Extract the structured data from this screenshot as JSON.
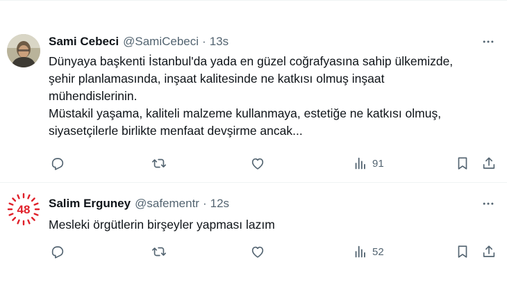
{
  "tweets": [
    {
      "name": "Sami Cebeci",
      "handle": "@SamiCebeci",
      "separator": "·",
      "time": "13s",
      "lines": [
        "Dünyaya başkenti İstanbul'da yada en güzel coğrafyasına sahip ülkemizde,",
        "şehir planlamasında, inşaat kalitesinde ne katkısı olmuş inşaat",
        "mühendislerinin.",
        "Müstakil yaşama, kaliteli malzeme kullanmaya, estetiğe  ne katkısı olmuş,",
        "siyasetçilerle birlikte menfaat devşirme ancak..."
      ],
      "views": "91",
      "avatar_icon": "person-photo-avatar"
    },
    {
      "name": "Salim Erguney",
      "handle": "@safementr",
      "separator": "·",
      "time": "12s",
      "lines": [
        "Mesleki örgütlerin birşeyler yapması lazım"
      ],
      "views": "52",
      "avatar_icon": "48-logo-avatar",
      "avatar_logo_text": "48"
    }
  ],
  "icons": {
    "reply": "reply-icon",
    "retweet": "retweet-icon",
    "like": "like-icon",
    "views": "views-icon",
    "bookmark": "bookmark-icon",
    "share": "share-icon",
    "more": "more-icon"
  },
  "colors": {
    "text": "#0f1419",
    "secondary": "#536471",
    "divider": "#eff3f4",
    "logo_red": "#e0202a"
  }
}
